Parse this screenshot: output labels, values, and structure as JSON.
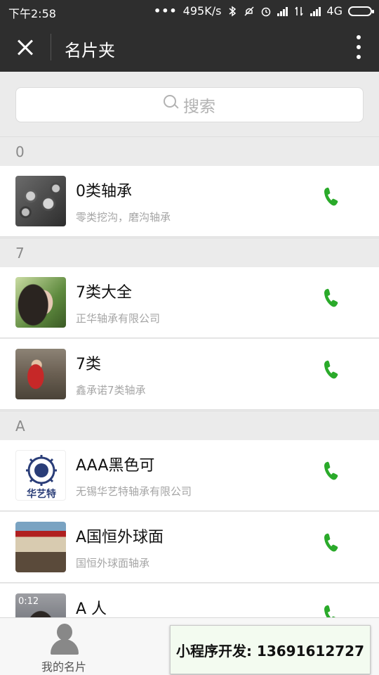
{
  "status_bar": {
    "time": "下午2:58",
    "dots": "•••",
    "net_speed": "495K/s",
    "network": "4G",
    "icons": [
      "bluetooth-icon",
      "mute-icon",
      "alarm-icon",
      "signal-icon",
      "data-icon",
      "signal-icon",
      "battery-icon"
    ]
  },
  "header": {
    "title": "名片夹",
    "close_icon": "close-icon",
    "more_icon": "more-vertical-icon"
  },
  "search": {
    "placeholder": "搜索",
    "icon": "search-icon"
  },
  "sections": [
    {
      "letter": "0",
      "contacts": [
        {
          "name": "0类轴承",
          "desc": "零类挖沟，磨沟轴承"
        }
      ]
    },
    {
      "letter": "7",
      "contacts": [
        {
          "name": "7类大全",
          "desc": "正华轴承有限公司"
        },
        {
          "name": "7类",
          "desc": "鑫承诺7类轴承"
        }
      ]
    },
    {
      "letter": "A",
      "contacts": [
        {
          "name": "AAA黑色可",
          "desc": "无锡华艺特轴承有限公司"
        },
        {
          "name": "A国恒外球面",
          "desc": "国恒外球面轴承"
        },
        {
          "name": "A 人",
          "desc": "",
          "avatar_text": "0:12"
        }
      ]
    }
  ],
  "logo_text": "华艺特",
  "phone_icon": "phone-icon",
  "phone_color": "#2aaa2a",
  "tab_bar": {
    "tab_mycard_label": "我的名片",
    "tab_mycard_icon": "person-icon"
  },
  "promo_banner": "小程序开发: 13691612727"
}
